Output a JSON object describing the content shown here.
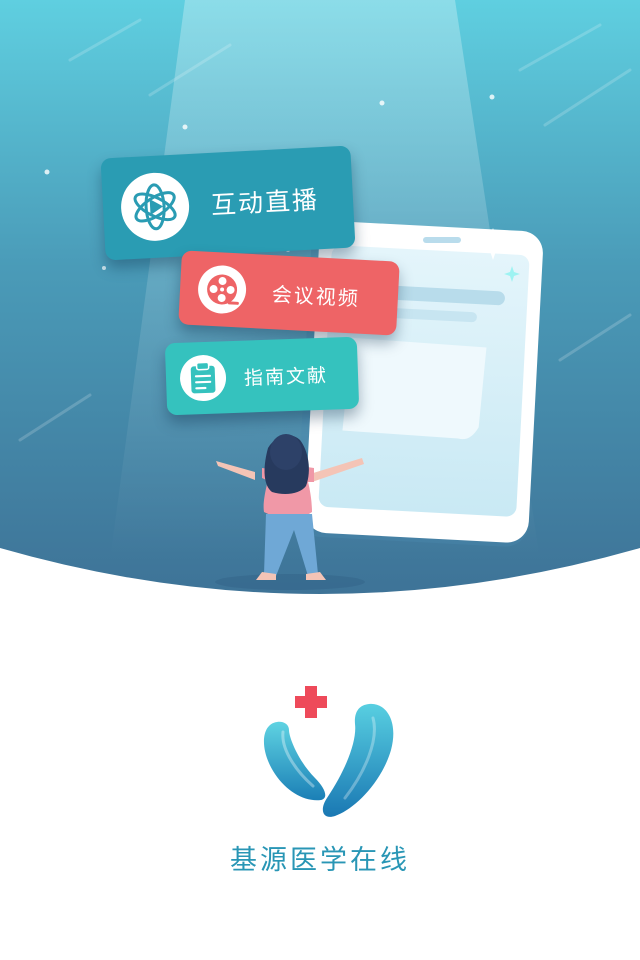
{
  "cards": {
    "live": {
      "label": "互动直播",
      "icon": "play-atom-icon",
      "color": "#2a9cb3"
    },
    "video": {
      "label": "会议视频",
      "icon": "film-reel-icon",
      "color": "#ee6466"
    },
    "guide": {
      "label": "指南文献",
      "icon": "clipboard-icon",
      "color": "#35c2be"
    }
  },
  "brand": {
    "name": "基源医学在线",
    "logo": "medical-v-logo",
    "color": "#2996b5",
    "cross_color": "#ee4a5a"
  },
  "colors": {
    "hero_top": "#5fcfe0",
    "hero_bottom": "#3e7397"
  }
}
